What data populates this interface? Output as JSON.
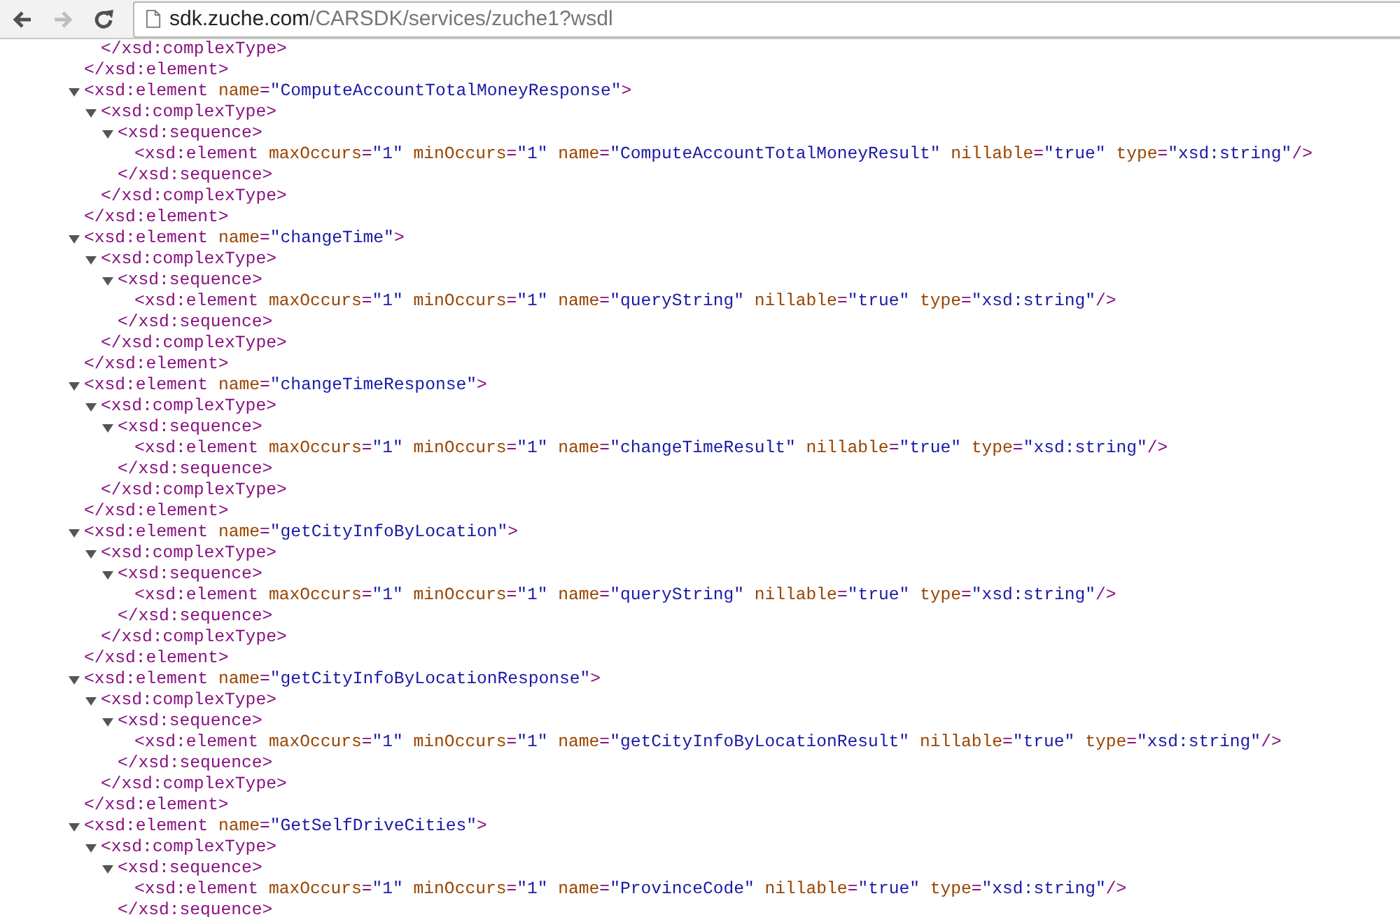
{
  "toolbar": {
    "back": {
      "disabled": false
    },
    "forward": {
      "disabled": true
    },
    "address": {
      "host": "sdk.zuche.com",
      "path": "/CARSDK/services/zuche1?wsdl"
    }
  },
  "syntax": {
    "open": "<",
    "close": ">",
    "end_open": "</",
    "self_close": "/>",
    "equals": "=",
    "quote": "\""
  },
  "nodes": [
    {
      "close_tag": "xsd:element",
      "children": [
        {
          "close_tag": "xsd:complexType"
        }
      ]
    },
    {
      "tag": "xsd:element",
      "close_tag": "xsd:element",
      "expanded": true,
      "attributes": [
        {
          "name": "name",
          "value": "ComputeAccountTotalMoneyResponse"
        }
      ],
      "children": [
        {
          "tag": "xsd:complexType",
          "close_tag": "xsd:complexType",
          "expanded": true,
          "children": [
            {
              "tag": "xsd:sequence",
              "close_tag": "xsd:sequence",
              "expanded": true,
              "children": [
                {
                  "tag": "xsd:element",
                  "self_closing": true,
                  "attributes": [
                    {
                      "name": "maxOccurs",
                      "value": "1"
                    },
                    {
                      "name": "minOccurs",
                      "value": "1"
                    },
                    {
                      "name": "name",
                      "value": "ComputeAccountTotalMoneyResult"
                    },
                    {
                      "name": "nillable",
                      "value": "true"
                    },
                    {
                      "name": "type",
                      "value": "xsd:string"
                    }
                  ]
                }
              ]
            }
          ]
        }
      ]
    },
    {
      "tag": "xsd:element",
      "close_tag": "xsd:element",
      "expanded": true,
      "attributes": [
        {
          "name": "name",
          "value": "changeTime"
        }
      ],
      "children": [
        {
          "tag": "xsd:complexType",
          "close_tag": "xsd:complexType",
          "expanded": true,
          "children": [
            {
              "tag": "xsd:sequence",
              "close_tag": "xsd:sequence",
              "expanded": true,
              "children": [
                {
                  "tag": "xsd:element",
                  "self_closing": true,
                  "attributes": [
                    {
                      "name": "maxOccurs",
                      "value": "1"
                    },
                    {
                      "name": "minOccurs",
                      "value": "1"
                    },
                    {
                      "name": "name",
                      "value": "queryString"
                    },
                    {
                      "name": "nillable",
                      "value": "true"
                    },
                    {
                      "name": "type",
                      "value": "xsd:string"
                    }
                  ]
                }
              ]
            }
          ]
        }
      ]
    },
    {
      "tag": "xsd:element",
      "close_tag": "xsd:element",
      "expanded": true,
      "attributes": [
        {
          "name": "name",
          "value": "changeTimeResponse"
        }
      ],
      "children": [
        {
          "tag": "xsd:complexType",
          "close_tag": "xsd:complexType",
          "expanded": true,
          "children": [
            {
              "tag": "xsd:sequence",
              "close_tag": "xsd:sequence",
              "expanded": true,
              "children": [
                {
                  "tag": "xsd:element",
                  "self_closing": true,
                  "attributes": [
                    {
                      "name": "maxOccurs",
                      "value": "1"
                    },
                    {
                      "name": "minOccurs",
                      "value": "1"
                    },
                    {
                      "name": "name",
                      "value": "changeTimeResult"
                    },
                    {
                      "name": "nillable",
                      "value": "true"
                    },
                    {
                      "name": "type",
                      "value": "xsd:string"
                    }
                  ]
                }
              ]
            }
          ]
        }
      ]
    },
    {
      "tag": "xsd:element",
      "close_tag": "xsd:element",
      "expanded": true,
      "attributes": [
        {
          "name": "name",
          "value": "getCityInfoByLocation"
        }
      ],
      "children": [
        {
          "tag": "xsd:complexType",
          "close_tag": "xsd:complexType",
          "expanded": true,
          "children": [
            {
              "tag": "xsd:sequence",
              "close_tag": "xsd:sequence",
              "expanded": true,
              "children": [
                {
                  "tag": "xsd:element",
                  "self_closing": true,
                  "attributes": [
                    {
                      "name": "maxOccurs",
                      "value": "1"
                    },
                    {
                      "name": "minOccurs",
                      "value": "1"
                    },
                    {
                      "name": "name",
                      "value": "queryString"
                    },
                    {
                      "name": "nillable",
                      "value": "true"
                    },
                    {
                      "name": "type",
                      "value": "xsd:string"
                    }
                  ]
                }
              ]
            }
          ]
        }
      ]
    },
    {
      "tag": "xsd:element",
      "close_tag": "xsd:element",
      "expanded": true,
      "attributes": [
        {
          "name": "name",
          "value": "getCityInfoByLocationResponse"
        }
      ],
      "children": [
        {
          "tag": "xsd:complexType",
          "close_tag": "xsd:complexType",
          "expanded": true,
          "children": [
            {
              "tag": "xsd:sequence",
              "close_tag": "xsd:sequence",
              "expanded": true,
              "children": [
                {
                  "tag": "xsd:element",
                  "self_closing": true,
                  "attributes": [
                    {
                      "name": "maxOccurs",
                      "value": "1"
                    },
                    {
                      "name": "minOccurs",
                      "value": "1"
                    },
                    {
                      "name": "name",
                      "value": "getCityInfoByLocationResult"
                    },
                    {
                      "name": "nillable",
                      "value": "true"
                    },
                    {
                      "name": "type",
                      "value": "xsd:string"
                    }
                  ]
                }
              ]
            }
          ]
        }
      ]
    },
    {
      "tag": "xsd:element",
      "expanded": true,
      "attributes": [
        {
          "name": "name",
          "value": "GetSelfDriveCities"
        }
      ],
      "children": [
        {
          "tag": "xsd:complexType",
          "expanded": true,
          "children": [
            {
              "tag": "xsd:sequence",
              "close_tag": "xsd:sequence",
              "expanded": true,
              "children": [
                {
                  "tag": "xsd:element",
                  "self_closing": true,
                  "attributes": [
                    {
                      "name": "maxOccurs",
                      "value": "1"
                    },
                    {
                      "name": "minOccurs",
                      "value": "1"
                    },
                    {
                      "name": "name",
                      "value": "ProvinceCode"
                    },
                    {
                      "name": "nillable",
                      "value": "true"
                    },
                    {
                      "name": "type",
                      "value": "xsd:string"
                    }
                  ]
                }
              ]
            }
          ]
        }
      ]
    }
  ]
}
